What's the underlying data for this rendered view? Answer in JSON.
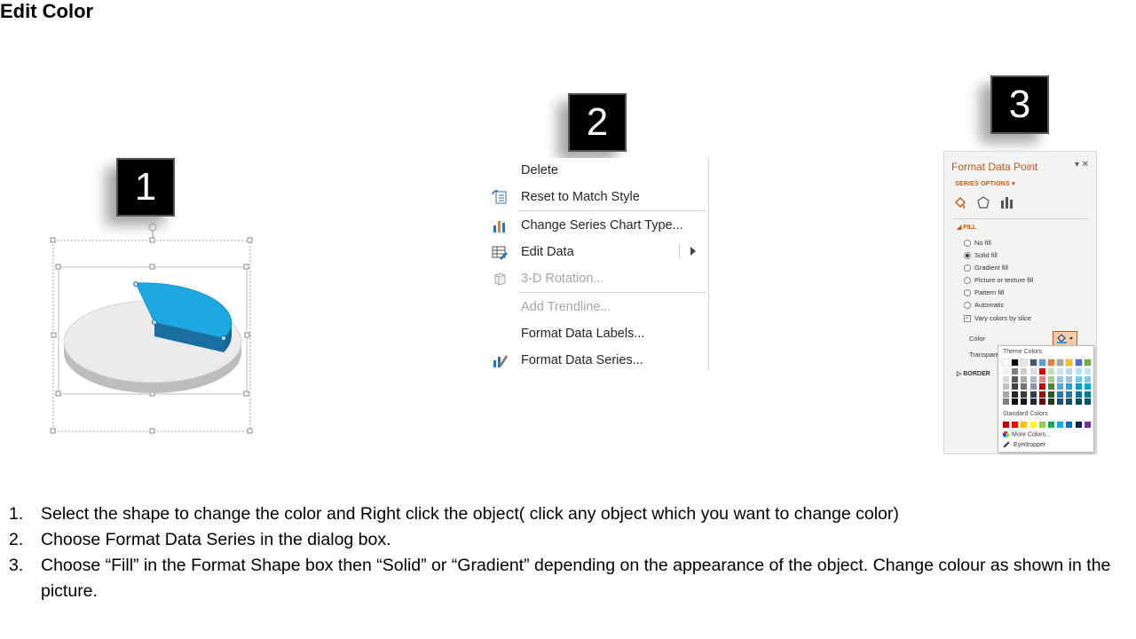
{
  "title": "Edit Color",
  "badges": [
    "1",
    "2",
    "3"
  ],
  "context_menu": {
    "items": [
      {
        "label": "Delete",
        "icon": "none",
        "enabled": true
      },
      {
        "label": "Reset to Match Style",
        "icon": "reset-style-icon",
        "enabled": true
      },
      {
        "label": "Change Series Chart Type...",
        "icon": "chart-type-icon",
        "enabled": true
      },
      {
        "label": "Edit Data",
        "icon": "edit-data-icon",
        "enabled": true,
        "submenu": true
      },
      {
        "label": "3-D Rotation...",
        "icon": "rotation-3d-icon",
        "enabled": false
      },
      {
        "label": "Add Trendline...",
        "icon": "none",
        "enabled": false
      },
      {
        "label": "Format Data Labels...",
        "icon": "none",
        "enabled": true
      },
      {
        "label": "Format Data Series...",
        "icon": "format-series-icon",
        "enabled": true
      }
    ]
  },
  "format_pane": {
    "title": "Format Data Point",
    "controls": "▾ ✕",
    "series_options": "SERIES OPTIONS ▾",
    "fill_heading": "◢ FILL",
    "fill_options": [
      {
        "label": "No fill",
        "type": "radio",
        "selected": false
      },
      {
        "label": "Solid fill",
        "type": "radio",
        "selected": true
      },
      {
        "label": "Gradient fill",
        "type": "radio",
        "selected": false
      },
      {
        "label": "Picture or texture fill",
        "type": "radio",
        "selected": false
      },
      {
        "label": "Pattern fill",
        "type": "radio",
        "selected": false
      },
      {
        "label": "Automatic",
        "type": "radio",
        "selected": false
      },
      {
        "label": "Vary colors by slice",
        "type": "checkbox",
        "selected": true
      }
    ],
    "color_label": "Color",
    "transparency_label": "Transparency",
    "border_heading": "▷ BORDER"
  },
  "palette": {
    "theme_heading": "Theme Colors",
    "standard_heading": "Standard Colors",
    "more_colors": "More Colors...",
    "eyedropper": "Eyedropper",
    "theme_top": [
      "#ffffff",
      "#000000",
      "#e7e6e6",
      "#44546a",
      "#5b9bd5",
      "#ed7d31",
      "#a5a5a5",
      "#ffc000",
      "#4472c4",
      "#70ad47"
    ],
    "theme_shade_cols": [
      [
        "#f2f2f2",
        "#d9d9d9",
        "#bfbfbf",
        "#a6a6a6",
        "#808080"
      ],
      [
        "#7f7f7f",
        "#595959",
        "#404040",
        "#262626",
        "#0d0d0d"
      ],
      [
        "#d0cece",
        "#aeaaaa",
        "#757171",
        "#3a3838",
        "#171616"
      ],
      [
        "#d6dce4",
        "#adb9ca",
        "#8497b0",
        "#333f4f",
        "#222a35"
      ],
      [
        "#e00000",
        "#f08080",
        "#c00000",
        "#a00000",
        "#700000"
      ],
      [
        "#c5e0b3",
        "#a8d08d",
        "#548235",
        "#375623",
        "#24391a"
      ],
      [
        "#c9e2f2",
        "#95c7e7",
        "#4aa7d8",
        "#2e75b6",
        "#1f4e79"
      ],
      [
        "#bdd7ee",
        "#9dc3e6",
        "#2e9dd1",
        "#1f78a8",
        "#145072"
      ],
      [
        "#b4e2f0",
        "#6fcbe3",
        "#0099c6",
        "#007199",
        "#004b66"
      ],
      [
        "#bfe6f0",
        "#80cde3",
        "#00a5c7",
        "#007a94",
        "#005163"
      ]
    ],
    "standard": [
      "#c00000",
      "#ff0000",
      "#ffc000",
      "#ffff00",
      "#92d050",
      "#00b050",
      "#00b0f0",
      "#0070c0",
      "#002060",
      "#7030a0"
    ]
  },
  "pie": {
    "slice_color": "#1fa7e1",
    "base_color": "#ebebeb"
  },
  "steps": [
    {
      "num": "1.",
      "text": "Select the shape to change the color and Right click the object( click any object which you want to change color)"
    },
    {
      "num": "2.",
      "text": "Choose Format Data Series in the dialog box."
    },
    {
      "num": "3.",
      "text": "Choose “Fill” in the Format Shape box then “Solid” or “Gradient” depending on the appearance of the object. Change colour as shown in the picture."
    }
  ]
}
